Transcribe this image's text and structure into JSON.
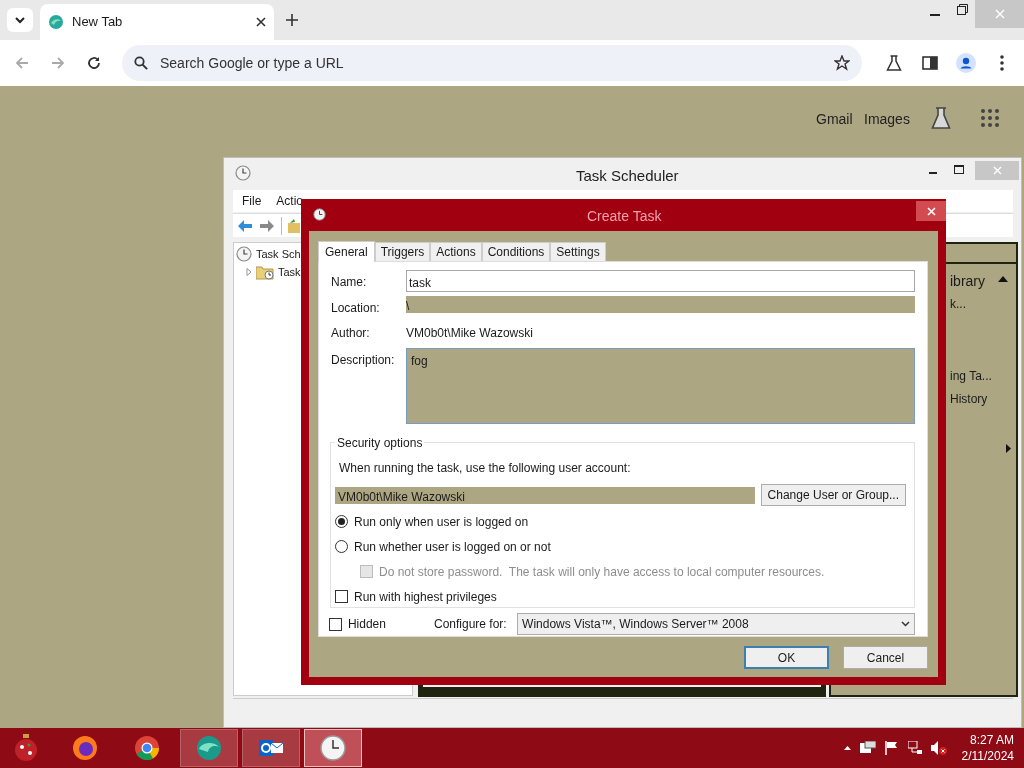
{
  "browser": {
    "tab": {
      "title": "New Tab"
    },
    "address": {
      "placeholder": "Search Google or type a URL"
    },
    "links": [
      "Gmail",
      "Images"
    ]
  },
  "task_scheduler": {
    "title": "Task Scheduler",
    "menu": [
      "File",
      "Actio"
    ],
    "tree": [
      {
        "label": "Task Sch",
        "children": [
          {
            "label": "Task",
            "expanded": false
          }
        ]
      }
    ],
    "actions_panel": [
      "ibrary",
      "k...",
      "ing Ta...",
      "History"
    ]
  },
  "dialog": {
    "title": "Create Task",
    "tabs": [
      {
        "label": "General",
        "selected": true
      },
      {
        "label": "Triggers",
        "selected": false
      },
      {
        "label": "Actions",
        "selected": false
      },
      {
        "label": "Conditions",
        "selected": false
      },
      {
        "label": "Settings",
        "selected": false
      }
    ],
    "fields": [
      {
        "label": "Name:",
        "value": "task",
        "kind": "input"
      },
      {
        "label": "Location:",
        "value": "\\",
        "kind": "readonly"
      },
      {
        "label": "Author:",
        "value": "VM0b0t\\Mike Wazowski",
        "kind": "text"
      },
      {
        "label": "Description:",
        "value": "fog",
        "kind": "area"
      }
    ],
    "security": {
      "legend": "Security options",
      "prompt": "When running the task, use the following user account:",
      "account": "VM0b0t\\Mike Wazowski",
      "change_button": "Change User or Group...",
      "options": [
        {
          "kind": "radio",
          "label": "Run only when user is logged on",
          "selected": true,
          "disabled": false
        },
        {
          "kind": "radio",
          "label": "Run whether user is logged on or not",
          "selected": false,
          "disabled": false
        },
        {
          "kind": "checkbox",
          "label": "Do not store password.  The task will only have access to local computer resources.",
          "checked": false,
          "disabled": true
        },
        {
          "kind": "checkbox",
          "label": "Run with highest privileges",
          "checked": false,
          "disabled": false
        }
      ]
    },
    "hidden": {
      "label": "Hidden",
      "checked": false
    },
    "configure": {
      "label": "Configure for:",
      "value": "Windows Vista™, Windows Server™ 2008"
    },
    "buttons": [
      {
        "label": "OK",
        "default": true
      },
      {
        "label": "Cancel",
        "default": false
      }
    ]
  },
  "taskbar": {
    "apps": [
      {
        "kind": "firefox",
        "open": false,
        "selected": false
      },
      {
        "kind": "chrome",
        "open": false,
        "selected": false
      },
      {
        "kind": "edge",
        "open": true,
        "selected": false
      },
      {
        "kind": "outlook",
        "open": true,
        "selected": false
      },
      {
        "kind": "clock",
        "open": true,
        "selected": true
      }
    ],
    "time": "8:27 AM",
    "date": "2/11/2024"
  }
}
